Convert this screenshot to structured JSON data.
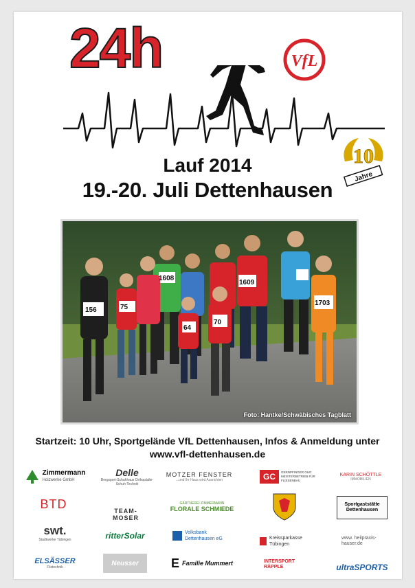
{
  "header": {
    "title_big": "24h",
    "lauf": "Lauf 2014",
    "date_line": "19.-20. Juli Dettenhausen",
    "club_logo": "VfL",
    "anniversary_number": "10",
    "anniversary_label": "Jahre"
  },
  "photo": {
    "credit": "Foto: Hantke/Schwäbisches Tagblatt",
    "bibs": [
      "156",
      "75",
      "1608",
      "1609",
      "64",
      "70",
      "1703"
    ]
  },
  "info": {
    "line1": "Startzeit: 10 Uhr, Sportgelände VfL Dettenhausen, Infos & Anmeldung unter",
    "line2": "www.vfl-dettenhausen.de"
  },
  "sponsors": {
    "zimmermann": "Zimmermann",
    "zimmermann_sub": "Holzwerke GmbH",
    "delle": "Delle",
    "delle_sub": "Bergsport-Schuhhaus Orthopädie-Schuh-Technik",
    "motzer": "MOTZER FENSTER",
    "motzer_sub": "...und Ihr Haus wird Ausrichten",
    "gc_logo": "GC",
    "gc_sub": "GERNPFINGER OHG MEISTERBETRIEB FÜR FLIESENBAU",
    "schoettle": "KARIN SCHÖTTLE",
    "schoettle_sub": "IMMOBILIEN",
    "btd": "BTD",
    "teammoser": "TEAM- MOSER",
    "florale": "FLORALE SCHMIEDE",
    "florale_sub": "GÄRTNEREI ZIMMERMANN",
    "sportgaststaette": "Sportgaststätte Dettenhausen",
    "swt": "swt.",
    "swt_sub": "Stadtwerke Tübingen",
    "rittersolar": "ritterSolar",
    "volksbank": "Volksbank Dettenhausen eG",
    "ksk": "Kreissparkasse Tübingen",
    "heilpraxis": "www. heilpraxis- hauser.de",
    "elsaesser": "ELSÄSSER",
    "elsaesser_sub": "Filztechnik",
    "neusser": "Neusser",
    "mummert": "Familie Mummert",
    "intersport": "INTERSPORT RÄPPLE",
    "ultrasports": "ultraSPORTS"
  },
  "colors": {
    "brand_red": "#d7232a",
    "text": "#111111",
    "yellow_badge": "#e8b400"
  }
}
